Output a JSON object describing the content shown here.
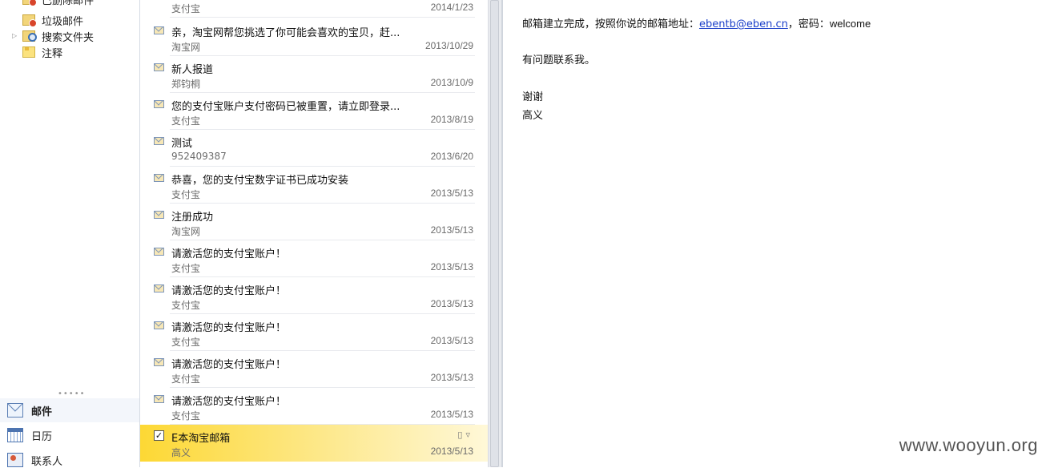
{
  "nav": {
    "top_partial": "已删除邮件",
    "folders": [
      {
        "label": "垃圾邮件",
        "icon": "junk-mail-icon"
      },
      {
        "label": "搜索文件夹",
        "icon": "search-folder-icon"
      },
      {
        "label": "注释",
        "icon": "notes-icon"
      }
    ],
    "grip": "•••••",
    "buttons": [
      {
        "label": "邮件",
        "icon": "mail-icon"
      },
      {
        "label": "日历",
        "icon": "calendar-icon"
      },
      {
        "label": "联系人",
        "icon": "contacts-icon"
      }
    ]
  },
  "messages": [
    {
      "subject": "",
      "from": "支付宝",
      "date": "2014/1/23"
    },
    {
      "subject": "亲，淘宝网帮您挑选了你可能会喜欢的宝贝，赶...",
      "from": "淘宝网",
      "date": "2013/10/29"
    },
    {
      "subject": "新人报道",
      "from": "郑钧桐",
      "date": "2013/10/9"
    },
    {
      "subject": "您的支付宝账户支付密码已被重置，请立即登录...",
      "from": "支付宝",
      "date": "2013/8/19"
    },
    {
      "subject": "测试",
      "from": "952409387",
      "date": "2013/6/20"
    },
    {
      "subject": "恭喜，您的支付宝数字证书已成功安装",
      "from": "支付宝",
      "date": "2013/5/13"
    },
    {
      "subject": "注册成功",
      "from": "淘宝网",
      "date": "2013/5/13"
    },
    {
      "subject": "请激活您的支付宝账户！",
      "from": "支付宝",
      "date": "2013/5/13"
    },
    {
      "subject": "请激活您的支付宝账户！",
      "from": "支付宝",
      "date": "2013/5/13"
    },
    {
      "subject": "请激活您的支付宝账户！",
      "from": "支付宝",
      "date": "2013/5/13"
    },
    {
      "subject": "请激活您的支付宝账户！",
      "from": "支付宝",
      "date": "2013/5/13"
    },
    {
      "subject": "请激活您的支付宝账户！",
      "from": "支付宝",
      "date": "2013/5/13"
    },
    {
      "subject": "E本淘宝邮箱",
      "from": "高义",
      "date": "2013/5/13",
      "selected": true
    }
  ],
  "reading": {
    "line1_prefix": "邮箱建立完成，按照你说的邮箱地址：",
    "email": "ebentb@eben.cn",
    "line1_mid": "，密码：",
    "password": "welcome",
    "line2": "有问题联系我。",
    "line3": "谢谢",
    "line4": "高义"
  },
  "watermark": "www.wooyun.org",
  "colors": {
    "selected_row": "#fdd834",
    "link": "#1a3fc9",
    "secondary_text": "#6b6b6b"
  }
}
